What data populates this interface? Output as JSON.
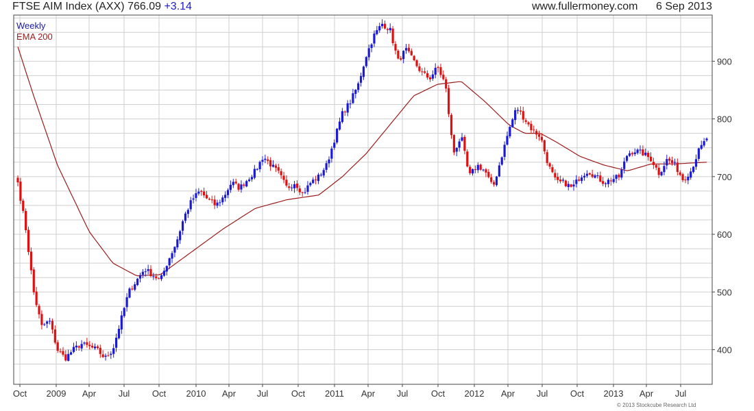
{
  "header": {
    "index_name": "FTSE AIM Index (AXX)",
    "last": "766.09",
    "change": "+3.14",
    "site": "www.fullermoney.com",
    "date": "6 Sep 2013"
  },
  "copyright": "© 2013 Stockcube Research Ltd",
  "colors": {
    "up": "#1a1ad6",
    "down": "#e01010",
    "ema": "#9b1b1b",
    "grid": "#cfcfcf",
    "weekly_label": "#1a1aa8"
  },
  "chart_data": {
    "type": "line",
    "x_ticks": [
      "Oct",
      "2009",
      "Apr",
      "Jul",
      "Oct",
      "2010",
      "Apr",
      "Jul",
      "Oct",
      "2011",
      "Apr",
      "Jul",
      "Oct",
      "2012",
      "Apr",
      "Jul",
      "Oct",
      "2013",
      "Apr",
      "Jul"
    ],
    "y_ticks": [
      400,
      500,
      600,
      700,
      800,
      900
    ],
    "ylim": [
      340,
      980
    ],
    "grid": true,
    "legend": "top-left",
    "series": [
      {
        "name": "Weekly",
        "style": "candlestick",
        "close_anchors": [
          [
            0,
            690
          ],
          [
            1,
            610
          ],
          [
            2,
            500
          ],
          [
            3,
            440
          ],
          [
            4,
            450
          ],
          [
            5,
            400
          ],
          [
            6,
            385
          ],
          [
            7,
            400
          ],
          [
            8,
            410
          ],
          [
            9,
            405
          ],
          [
            10,
            400
          ],
          [
            11,
            385
          ],
          [
            12,
            400
          ],
          [
            13,
            450
          ],
          [
            14,
            500
          ],
          [
            15,
            520
          ],
          [
            16,
            540
          ],
          [
            17,
            530
          ],
          [
            18,
            520
          ],
          [
            19,
            555
          ],
          [
            20,
            585
          ],
          [
            21,
            630
          ],
          [
            22,
            660
          ],
          [
            23,
            675
          ],
          [
            24,
            660
          ],
          [
            25,
            650
          ],
          [
            26,
            665
          ],
          [
            27,
            690
          ],
          [
            28,
            680
          ],
          [
            29,
            695
          ],
          [
            30,
            710
          ],
          [
            31,
            735
          ],
          [
            32,
            720
          ],
          [
            33,
            705
          ],
          [
            34,
            680
          ],
          [
            35,
            690
          ],
          [
            36,
            670
          ],
          [
            37,
            690
          ],
          [
            38,
            700
          ],
          [
            39,
            720
          ],
          [
            40,
            765
          ],
          [
            41,
            810
          ],
          [
            42,
            830
          ],
          [
            43,
            860
          ],
          [
            44,
            910
          ],
          [
            45,
            945
          ],
          [
            46,
            965
          ],
          [
            47,
            955
          ],
          [
            48,
            900
          ],
          [
            49,
            920
          ],
          [
            50,
            900
          ],
          [
            51,
            880
          ],
          [
            52,
            870
          ],
          [
            53,
            890
          ],
          [
            54,
            860
          ],
          [
            55,
            740
          ],
          [
            56,
            770
          ],
          [
            57,
            700
          ],
          [
            58,
            720
          ],
          [
            59,
            710
          ],
          [
            60,
            680
          ],
          [
            61,
            730
          ],
          [
            62,
            780
          ],
          [
            63,
            820
          ],
          [
            64,
            800
          ],
          [
            65,
            780
          ],
          [
            66,
            770
          ],
          [
            67,
            720
          ],
          [
            68,
            690
          ],
          [
            69,
            690
          ],
          [
            70,
            680
          ],
          [
            71,
            700
          ],
          [
            72,
            710
          ],
          [
            73,
            700
          ],
          [
            74,
            690
          ],
          [
            75,
            695
          ],
          [
            76,
            700
          ],
          [
            77,
            740
          ],
          [
            78,
            745
          ],
          [
            79,
            740
          ],
          [
            80,
            730
          ],
          [
            81,
            705
          ],
          [
            82,
            730
          ],
          [
            83,
            720
          ],
          [
            84,
            695
          ],
          [
            85,
            710
          ],
          [
            86,
            745
          ],
          [
            87,
            766
          ]
        ],
        "first_week": "2008-09-26",
        "last_week": "2013-09-06"
      },
      {
        "name": "EMA 200",
        "style": "line",
        "anchors": [
          [
            0,
            925
          ],
          [
            2,
            840
          ],
          [
            5,
            720
          ],
          [
            9,
            605
          ],
          [
            12,
            550
          ],
          [
            15,
            528
          ],
          [
            18,
            530
          ],
          [
            22,
            570
          ],
          [
            26,
            610
          ],
          [
            30,
            645
          ],
          [
            34,
            660
          ],
          [
            38,
            668
          ],
          [
            41,
            700
          ],
          [
            44,
            740
          ],
          [
            47,
            790
          ],
          [
            50,
            840
          ],
          [
            53,
            860
          ],
          [
            56,
            865
          ],
          [
            59,
            830
          ],
          [
            62,
            790
          ],
          [
            64,
            775
          ],
          [
            66,
            775
          ],
          [
            68,
            760
          ],
          [
            71,
            735
          ],
          [
            74,
            720
          ],
          [
            77,
            710
          ],
          [
            80,
            722
          ],
          [
            83,
            722
          ],
          [
            87,
            725
          ]
        ]
      }
    ]
  }
}
